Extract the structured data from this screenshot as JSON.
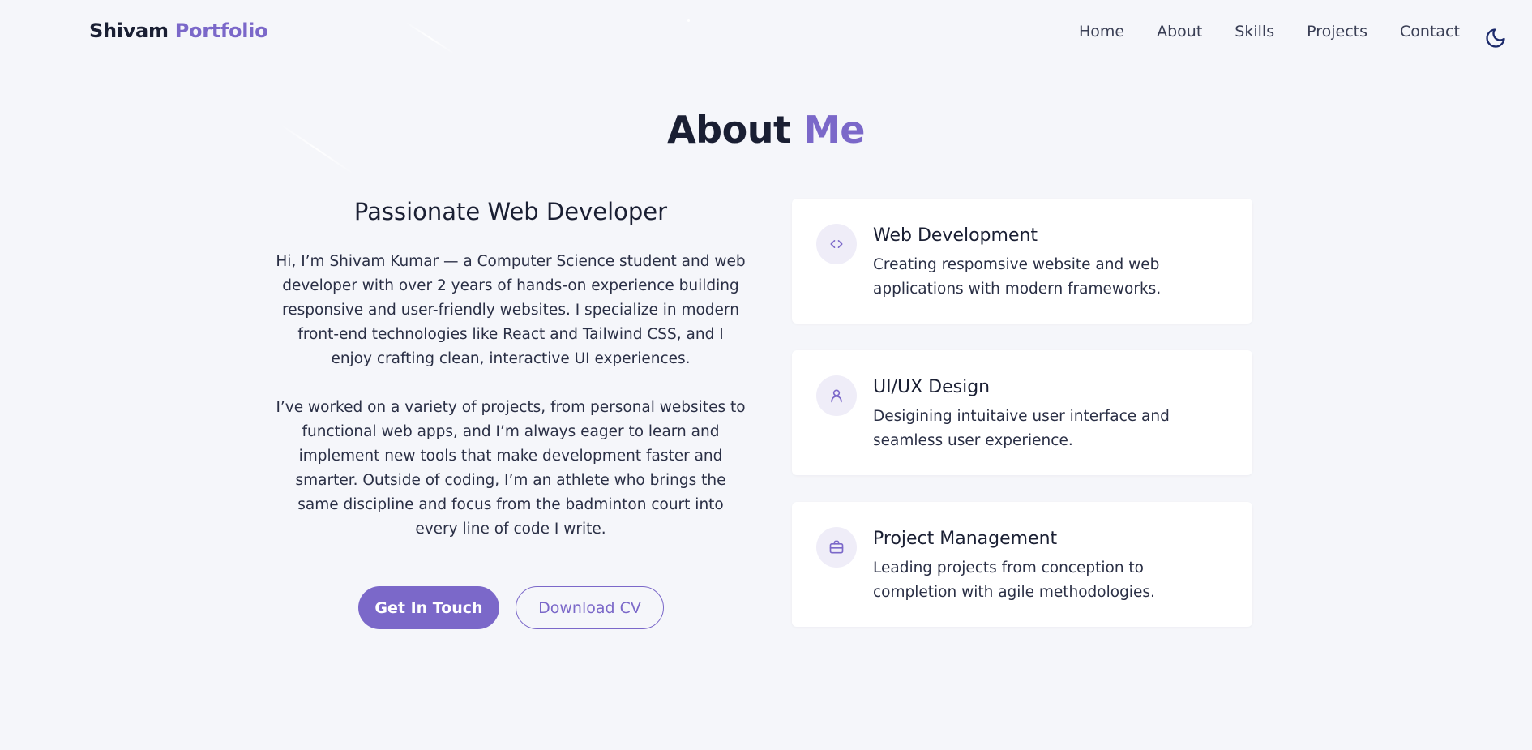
{
  "nav": {
    "brand_first": "Shivam",
    "brand_second": "Portfolio",
    "links": [
      "Home",
      "About",
      "Skills",
      "Projects",
      "Contact"
    ],
    "theme_icon": "moon-icon"
  },
  "about": {
    "title_first": "About",
    "title_second": "Me",
    "subtitle": "Passionate Web Developer",
    "paragraph1": "Hi, I’m Shivam Kumar — a Computer Science student and web developer with over 2 years of hands-on experience building responsive and user-friendly websites. I specialize in modern front-end technologies like React and Tailwind CSS, and I enjoy crafting clean, interactive UI experiences.",
    "paragraph2": "I’ve worked on a variety of projects, from personal websites to functional web apps, and I’m always eager to learn and implement new tools that make development faster and smarter. Outside of coding, I’m an athlete who brings the same discipline and focus from the badminton court into every line of code I write.",
    "primary_button": "Get In Touch",
    "secondary_button": "Download CV"
  },
  "cards": [
    {
      "icon": "code-icon",
      "title": "Web Development",
      "description": "Creating respomsive website and web applications with modern frameworks."
    },
    {
      "icon": "user-icon",
      "title": "UI/UX Design",
      "description": "Desigining intuitaive user interface and seamless user experience."
    },
    {
      "icon": "briefcase-icon",
      "title": "Project Management",
      "description": "Leading projects from conception to completion with agile methodologies."
    }
  ],
  "colors": {
    "accent": "#7b68c9",
    "text": "#1a1f33",
    "background": "#f5f6fa"
  }
}
